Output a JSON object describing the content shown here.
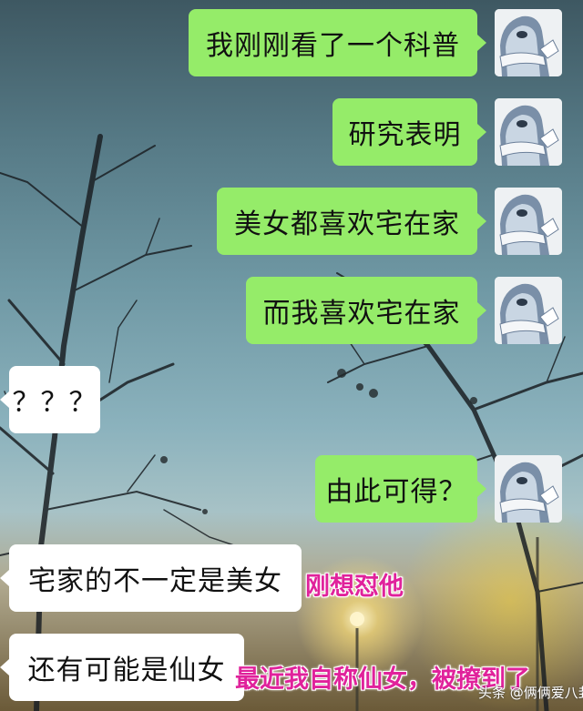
{
  "chat": {
    "messages": [
      {
        "side": "right",
        "text": "我刚刚看了一个科普"
      },
      {
        "side": "right",
        "text": "研究表明"
      },
      {
        "side": "right",
        "text": "美女都喜欢宅在家"
      },
      {
        "side": "right",
        "text": "而我喜欢宅在家"
      },
      {
        "side": "left",
        "text": "？？？"
      },
      {
        "side": "right",
        "text": "由此可得？"
      },
      {
        "side": "left",
        "text": "宅家的不一定是美女"
      },
      {
        "side": "left",
        "text": "还有可能是仙女"
      }
    ]
  },
  "annotations": {
    "note1": "刚想怼他",
    "note2": "最近我自称仙女，被撩到了"
  },
  "watermark": {
    "text": "头条 @俩俩爱八卦"
  },
  "colors": {
    "outgoing_bubble": "#95ec69",
    "incoming_bubble": "#ffffff",
    "annotation": "#e0229b"
  },
  "icons": {
    "avatar": "penguin-mascot-icon"
  }
}
